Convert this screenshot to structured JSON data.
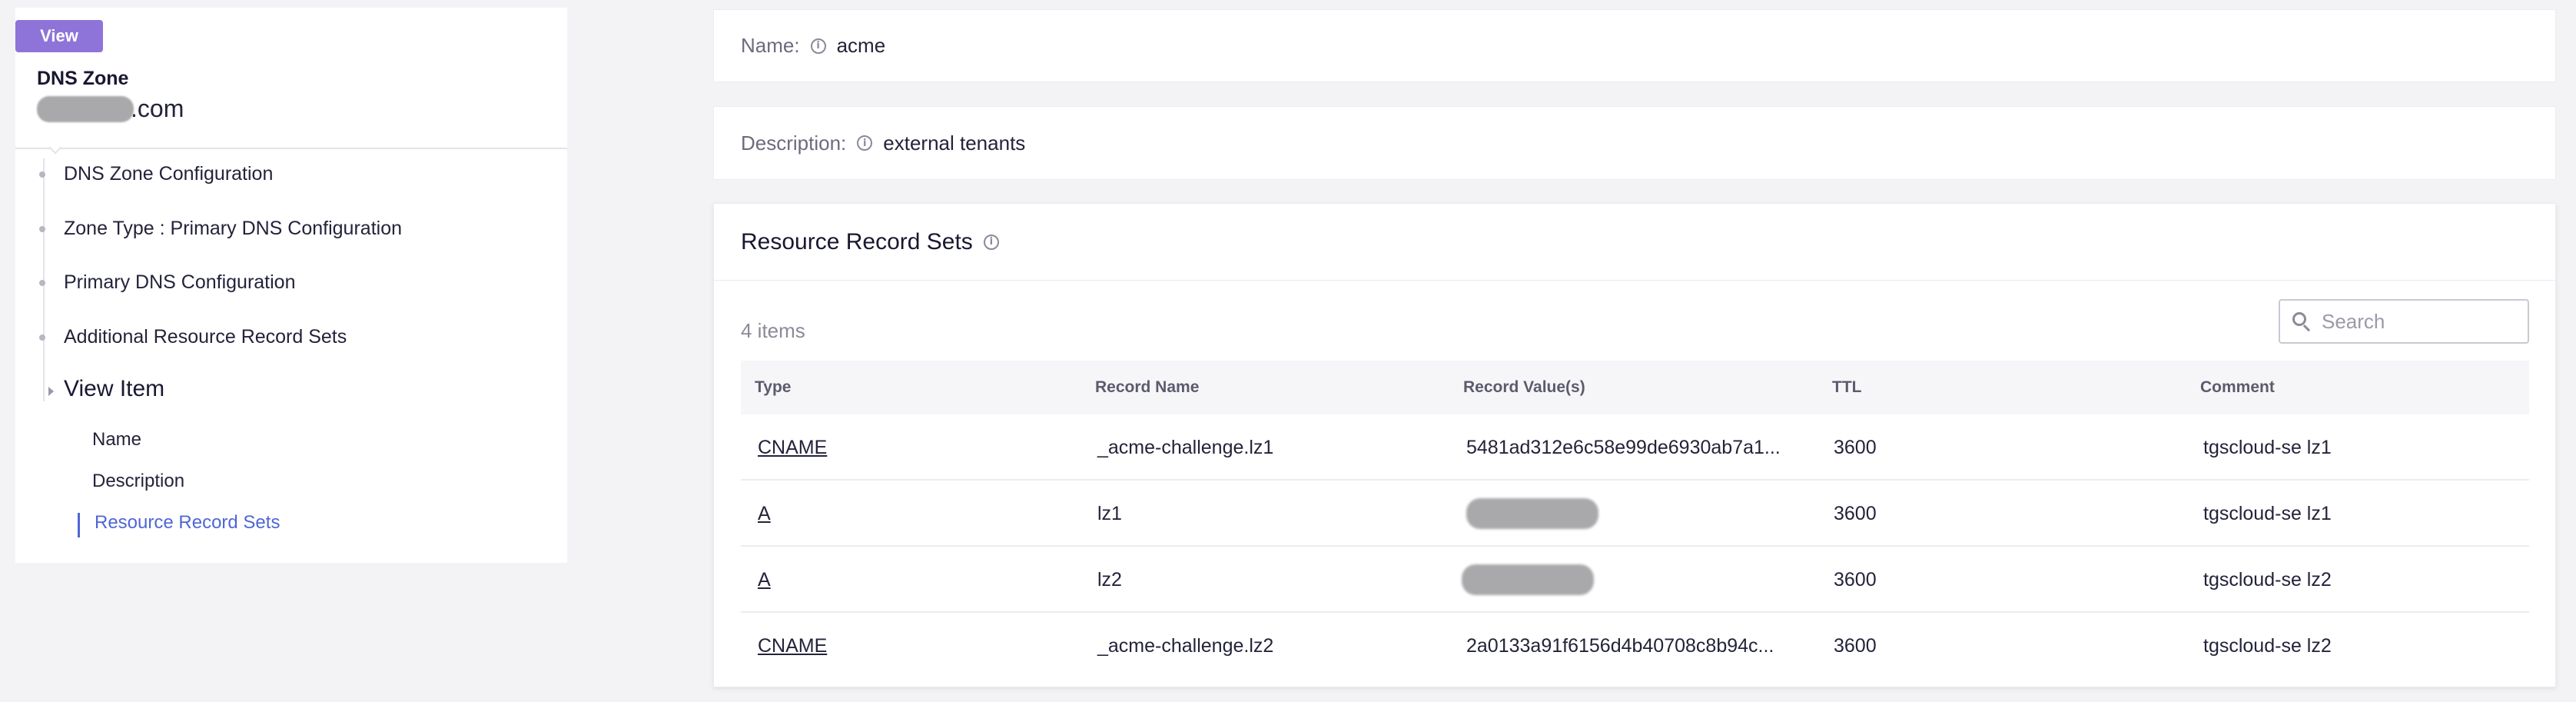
{
  "badge": "View",
  "zone": {
    "label": "DNS Zone",
    "name_suffix": ".com"
  },
  "nav": {
    "items": [
      {
        "label": "DNS Zone Configuration"
      },
      {
        "label": "Zone Type : Primary DNS Configuration"
      },
      {
        "label": "Primary DNS Configuration"
      },
      {
        "label": "Additional Resource Record Sets"
      }
    ],
    "view_item": {
      "label": "View Item",
      "children": [
        {
          "label": "Name"
        },
        {
          "label": "Description"
        },
        {
          "label": "Resource Record Sets",
          "active": true
        }
      ]
    },
    "active_color": "#4f66d6"
  },
  "fields": {
    "name": {
      "label": "Name:",
      "value": "acme"
    },
    "description": {
      "label": "Description:",
      "value": "external tenants"
    }
  },
  "rrs": {
    "title": "Resource Record Sets",
    "count": "4 items",
    "search_placeholder": "Search",
    "columns": [
      "Type",
      "Record Name",
      "Record Value(s)",
      "TTL",
      "Comment"
    ],
    "rows": [
      {
        "type": "CNAME",
        "name": "_acme-challenge.lz1",
        "value": "5481ad312e6c58e99de6930ab7a1...",
        "ttl": "3600",
        "comment": "tgscloud-se lz1"
      },
      {
        "type": "A",
        "name": "lz1",
        "value": "",
        "ttl": "3600",
        "comment": "tgscloud-se lz1"
      },
      {
        "type": "A",
        "name": "lz2",
        "value": "",
        "ttl": "3600",
        "comment": "tgscloud-se lz2"
      },
      {
        "type": "CNAME",
        "name": "_acme-challenge.lz2",
        "value": "2a0133a91f6156d4b40708c8b94c...",
        "ttl": "3600",
        "comment": "tgscloud-se lz2"
      }
    ]
  },
  "colors": {
    "badge": "#8e74d8",
    "link_active": "#4f66d6",
    "background": "#f3f3f5"
  }
}
